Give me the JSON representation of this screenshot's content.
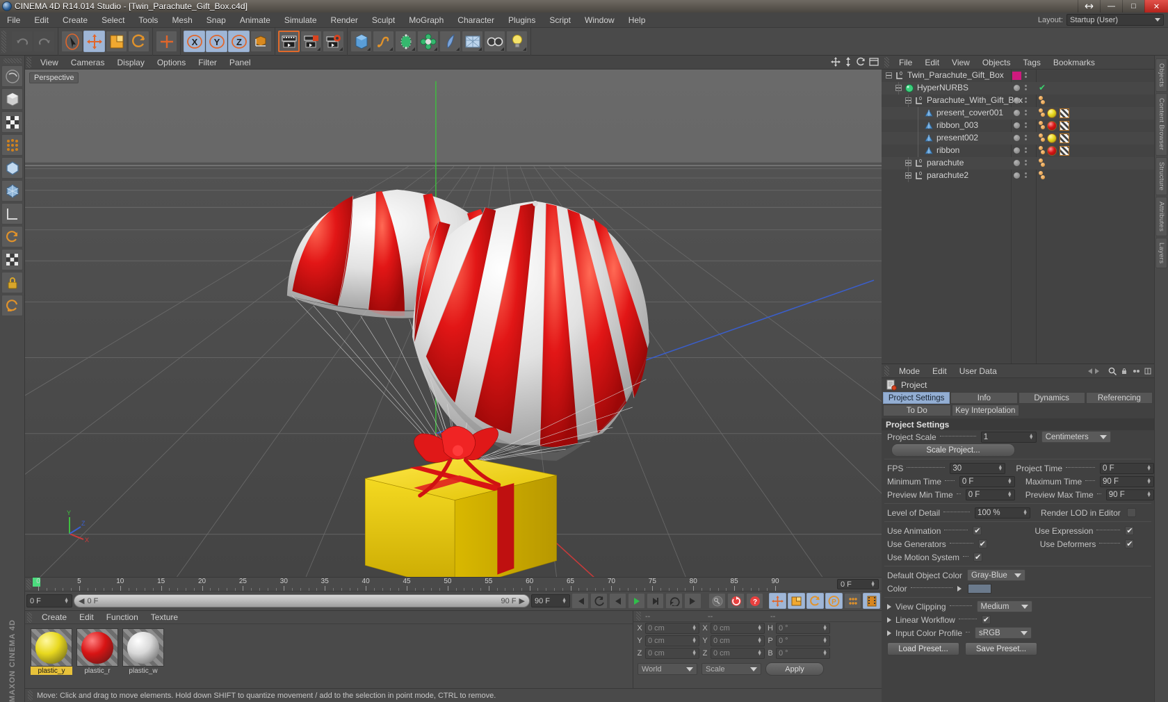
{
  "titlebar": {
    "text": "CINEMA 4D R14.014 Studio - [Twin_Parachute_Gift_Box.c4d]",
    "minimize": "—",
    "restore": "❐",
    "maximize": "□",
    "close": "✕",
    "icon": "c4d-app-icon"
  },
  "menubar": {
    "items": [
      "File",
      "Edit",
      "Create",
      "Select",
      "Tools",
      "Mesh",
      "Snap",
      "Animate",
      "Simulate",
      "Render",
      "Sculpt",
      "MoGraph",
      "Character",
      "Plugins",
      "Script",
      "Window",
      "Help"
    ],
    "layout_label": "Layout:",
    "layout_value": "Startup (User)"
  },
  "toolbar": {
    "groups": [
      {
        "name": "undo-group",
        "buttons": [
          {
            "name": "undo-button",
            "icon": "undo-icon",
            "state": "disabled"
          },
          {
            "name": "redo-button",
            "icon": "redo-icon",
            "state": "disabled"
          }
        ]
      },
      {
        "name": "tools-group",
        "buttons": [
          {
            "name": "live-selection-tool",
            "icon": "cursor-icon",
            "state": "framed"
          },
          {
            "name": "move-tool",
            "icon": "move-icon",
            "state": "active"
          },
          {
            "name": "scale-tool",
            "icon": "scale-icon",
            "state": "normal"
          },
          {
            "name": "rotate-tool",
            "icon": "rotate-icon",
            "state": "normal"
          }
        ]
      },
      {
        "name": "world-group",
        "buttons": [
          {
            "name": "world-object-axis-button",
            "icon": "plus-axis-icon",
            "state": "normal"
          }
        ]
      },
      {
        "name": "axis-lock-group",
        "buttons": [
          {
            "name": "lock-x-axis-button",
            "icon": "x-axis-icon",
            "state": "active"
          },
          {
            "name": "lock-y-axis-button",
            "icon": "y-axis-icon",
            "state": "active"
          },
          {
            "name": "lock-z-axis-button",
            "icon": "z-axis-icon",
            "state": "active"
          },
          {
            "name": "world-coordinate-button",
            "icon": "world-cube-icon",
            "state": "normal"
          }
        ]
      },
      {
        "name": "render-group",
        "buttons": [
          {
            "name": "render-view-button",
            "icon": "clapper-icon",
            "state": "framed"
          },
          {
            "name": "render-region-button",
            "icon": "clapper-region-icon",
            "state": "normal"
          },
          {
            "name": "render-settings-button",
            "icon": "clapper-gear-icon",
            "state": "normal"
          }
        ]
      },
      {
        "name": "primitives-group",
        "buttons": [
          {
            "name": "add-cube-button",
            "icon": "cube-icon",
            "state": "normal"
          },
          {
            "name": "add-spline-button",
            "icon": "spline-icon",
            "state": "normal"
          },
          {
            "name": "add-nurbs-button",
            "icon": "hypernurbs-icon",
            "state": "normal"
          },
          {
            "name": "add-modeling-object-button",
            "icon": "array-icon",
            "state": "normal"
          },
          {
            "name": "add-deformer-button",
            "icon": "bend-deformer-icon",
            "state": "normal"
          },
          {
            "name": "add-environment-button",
            "icon": "floor-icon",
            "state": "normal"
          },
          {
            "name": "add-camera-button",
            "icon": "camera-icon",
            "state": "normal"
          },
          {
            "name": "add-light-button",
            "icon": "light-bulb-icon",
            "state": "normal"
          }
        ]
      }
    ]
  },
  "leftbar": {
    "buttons": [
      {
        "name": "tool-undo-left",
        "icon": "undo-left-icon"
      },
      {
        "name": "model-mode-button",
        "icon": "model-mode-icon"
      },
      {
        "name": "texture-mode-button",
        "icon": "texture-checker-icon"
      },
      {
        "name": "points-mode-button",
        "icon": "points-mode-icon"
      },
      {
        "name": "edges-mode-button",
        "icon": "edges-mode-icon"
      },
      {
        "name": "polygons-mode-button",
        "icon": "polygons-mode-icon"
      },
      {
        "name": "axis-mode-button",
        "icon": "axis-mode-icon"
      },
      {
        "name": "enable-axis-button",
        "icon": "enable-axis-icon"
      },
      {
        "name": "viewport-solo-button",
        "icon": "viewport-solo-icon"
      },
      {
        "name": "lock-workplane-button",
        "icon": "lock-icon"
      },
      {
        "name": "workplane-button",
        "icon": "workplane-icon"
      }
    ],
    "brand": "MAXON CINEMA 4D"
  },
  "viewport": {
    "menu": [
      "View",
      "Cameras",
      "Display",
      "Options",
      "Filter",
      "Panel"
    ],
    "label": "Perspective",
    "icons": [
      "move-view-icon",
      "scale-view-icon",
      "rotate-view-icon",
      "maximize-view-icon"
    ],
    "axis_labels": {
      "x": "X",
      "y": "Y",
      "z": "Z"
    }
  },
  "timeline": {
    "ticks": [
      0,
      5,
      10,
      15,
      20,
      25,
      30,
      35,
      40,
      45,
      50,
      55,
      60,
      65,
      70,
      75,
      80,
      85,
      90
    ],
    "current_frame": "0 F",
    "right_field": "0 F"
  },
  "transport": {
    "current_frame_field": "0 F",
    "powerbar_value": "0 F",
    "range_end_field": "90 F",
    "max_field": "90 F",
    "buttons": [
      {
        "name": "go-to-start-button",
        "icon": "skip-start-icon"
      },
      {
        "name": "play-backwards-frame-button",
        "icon": "prev-frame-icon"
      },
      {
        "name": "play-back-button",
        "icon": "play-back-icon"
      },
      {
        "name": "play-forward-button",
        "icon": "play-icon",
        "state": "green"
      },
      {
        "name": "next-frame-button",
        "icon": "next-frame-icon"
      },
      {
        "name": "play-loop-button",
        "icon": "loop-icon"
      },
      {
        "name": "go-to-end-button",
        "icon": "skip-end-icon"
      },
      {
        "name": "record-active-objects-button",
        "icon": "key-icon"
      },
      {
        "name": "autokeying-button",
        "icon": "autokey-icon"
      },
      {
        "name": "keyframe-selection-button",
        "icon": "question-key-icon"
      },
      {
        "name": "position-key-button",
        "icon": "move-key-icon",
        "state": "on"
      },
      {
        "name": "scale-key-button",
        "icon": "scale-key-icon",
        "state": "on"
      },
      {
        "name": "rotation-key-button",
        "icon": "rotate-key-icon",
        "state": "on"
      },
      {
        "name": "parameter-key-button",
        "icon": "param-key-icon",
        "state": "on"
      },
      {
        "name": "point-level-animation-button",
        "icon": "pla-icon"
      },
      {
        "name": "timeline-filter-button",
        "icon": "film-strip-icon",
        "state": "on"
      }
    ]
  },
  "material_manager": {
    "menu": [
      "Create",
      "Edit",
      "Function",
      "Texture"
    ],
    "materials": [
      {
        "name": "plastic_y",
        "color": "#e8d81e",
        "highlight": "#fff8a0",
        "selected": true
      },
      {
        "name": "plastic_r",
        "color": "#d81414",
        "highlight": "#ff8080",
        "selected": false
      },
      {
        "name": "plastic_w",
        "color": "#d8d8d8",
        "highlight": "#ffffff",
        "selected": false
      }
    ]
  },
  "coordinates": {
    "headers": [
      "--",
      "--",
      "--"
    ],
    "rows": [
      {
        "axis1": "X",
        "value1": "0 cm",
        "axis2": "X",
        "value2": "0 cm",
        "axis3": "H",
        "value3": "0 °"
      },
      {
        "axis1": "Y",
        "value1": "0 cm",
        "axis2": "Y",
        "value2": "0 cm",
        "axis3": "P",
        "value3": "0 °"
      },
      {
        "axis1": "Z",
        "value1": "0 cm",
        "axis2": "Z",
        "value2": "0 cm",
        "axis3": "B",
        "value3": "0 °"
      }
    ],
    "world_select": "World",
    "scale_select": "Scale",
    "apply_button": "Apply"
  },
  "statusbar": {
    "text": "Move: Click and drag to move elements. Hold down SHIFT to quantize movement / add to the selection in point mode, CTRL to remove."
  },
  "object_manager": {
    "menu": [
      "File",
      "Edit",
      "View",
      "Objects",
      "Tags",
      "Bookmarks"
    ],
    "rows": [
      {
        "name": "Twin_Parachute_Gift_Box",
        "indent": 0,
        "icon": "null-object-icon",
        "expander": "minus",
        "swatch": "#cf1a7e",
        "tags": [],
        "check": false
      },
      {
        "name": "HyperNURBS",
        "indent": 1,
        "icon": "hypernurbs-green-icon",
        "expander": "minus",
        "swatch": "",
        "tags": [],
        "check": true
      },
      {
        "name": "Parachute_With_Gift_Box",
        "indent": 2,
        "icon": "null-object-icon",
        "expander": "minus",
        "swatch": "",
        "tags": [
          "dots"
        ],
        "check": false
      },
      {
        "name": "present_cover001",
        "indent": 3,
        "icon": "polygon-object-icon",
        "expander": "none",
        "swatch": "",
        "tags": [
          "dots",
          "yellow",
          "checker"
        ],
        "check": false
      },
      {
        "name": "ribbon_003",
        "indent": 3,
        "icon": "polygon-object-icon",
        "expander": "none",
        "swatch": "",
        "tags": [
          "dots",
          "red",
          "checker"
        ],
        "check": false
      },
      {
        "name": "present002",
        "indent": 3,
        "icon": "polygon-object-icon",
        "expander": "none",
        "swatch": "",
        "tags": [
          "dots",
          "yellow",
          "checker"
        ],
        "check": false
      },
      {
        "name": "ribbon",
        "indent": 3,
        "icon": "polygon-object-icon",
        "expander": "none",
        "swatch": "",
        "tags": [
          "dots",
          "red",
          "checker"
        ],
        "check": false
      },
      {
        "name": "parachute",
        "indent": 2,
        "icon": "null-object-icon",
        "expander": "plus",
        "swatch": "",
        "tags": [
          "dots"
        ],
        "check": false
      },
      {
        "name": "parachute2",
        "indent": 2,
        "icon": "null-object-icon",
        "expander": "plus",
        "swatch": "",
        "tags": [
          "dots"
        ],
        "check": false
      }
    ]
  },
  "attribute_manager": {
    "menu": [
      "Mode",
      "Edit",
      "User Data"
    ],
    "title": "Project",
    "tabs_row1": [
      "Project Settings",
      "Info",
      "Dynamics",
      "Referencing"
    ],
    "tabs_row2": [
      "To Do",
      "Key Interpolation"
    ],
    "active_tab": "Project Settings",
    "section_title": "Project Settings",
    "fields": {
      "project_scale_label": "Project Scale",
      "project_scale_value": "1",
      "project_scale_unit": "Centimeters",
      "scale_project_button": "Scale Project...",
      "fps_label": "FPS",
      "fps_value": "30",
      "project_time_label": "Project Time",
      "project_time_value": "0 F",
      "minimum_time_label": "Minimum Time",
      "minimum_time_value": "0 F",
      "maximum_time_label": "Maximum Time",
      "maximum_time_value": "90 F",
      "preview_min_label": "Preview Min Time",
      "preview_min_value": "0 F",
      "preview_max_label": "Preview Max Time",
      "preview_max_value": "90 F",
      "lod_label": "Level of Detail",
      "lod_value": "100 %",
      "render_lod_label": "Render LOD in Editor",
      "render_lod_checked": false,
      "use_animation_label": "Use Animation",
      "use_animation_checked": true,
      "use_expression_label": "Use Expression",
      "use_expression_checked": true,
      "use_generators_label": "Use Generators",
      "use_generators_checked": true,
      "use_deformers_label": "Use Deformers",
      "use_deformers_checked": true,
      "use_motion_label": "Use Motion System",
      "use_motion_checked": true,
      "default_object_color_label": "Default Object Color",
      "default_object_color_value": "Gray-Blue",
      "color_label": "Color",
      "color_swatch": "#6b7a8c",
      "view_clipping_label": "View Clipping",
      "view_clipping_value": "Medium",
      "linear_workflow_label": "Linear Workflow",
      "linear_workflow_checked": true,
      "input_color_profile_label": "Input Color Profile",
      "input_color_profile_value": "sRGB",
      "load_preset_button": "Load Preset...",
      "save_preset_button": "Save Preset..."
    }
  },
  "right_edge_tabs": [
    "Objects",
    "Content Browser",
    "Structure",
    "Attributes",
    "Layers"
  ]
}
